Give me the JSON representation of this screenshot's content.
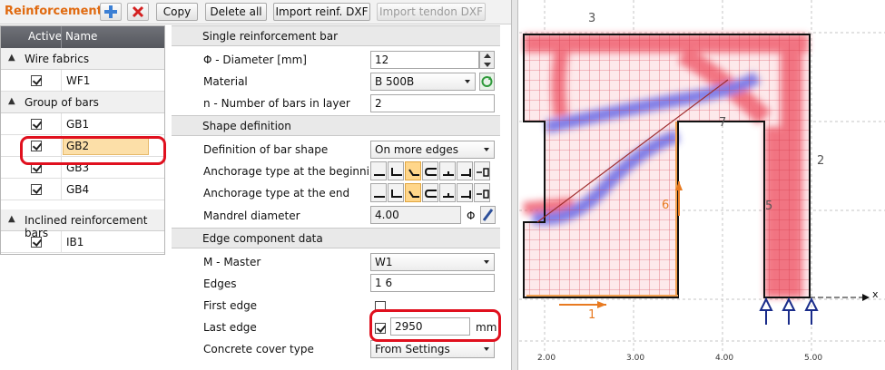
{
  "toolbar": {
    "title": "Reinforcement",
    "add_icon": "plus-icon",
    "delete_icon": "delete-x-icon",
    "copy_label": "Copy",
    "delete_all_label": "Delete all",
    "import_reinf_label": "Import reinf. DXF",
    "import_tendon_label": "Import tendon DXF"
  },
  "tree": {
    "col_active": "Active",
    "col_name": "Name",
    "groups": [
      {
        "label": "Wire fabrics",
        "items": [
          {
            "name": "WF1",
            "active": true
          }
        ]
      },
      {
        "label": "Group of bars",
        "items": [
          {
            "name": "GB1",
            "active": true
          },
          {
            "name": "GB2",
            "active": true,
            "selected": true
          },
          {
            "name": "GB3",
            "active": true
          },
          {
            "name": "GB4",
            "active": true
          }
        ]
      },
      {
        "label": "Inclined reinforcement bars",
        "items": [
          {
            "name": "IB1",
            "active": true
          }
        ]
      }
    ]
  },
  "props": {
    "sec_single": "Single reinforcement bar",
    "diameter_label": "Φ - Diameter [mm]",
    "diameter_value": "12",
    "material_label": "Material",
    "material_value": "B 500B",
    "nbars_label": "n - Number of bars in layer",
    "nbars_value": "2",
    "sec_shape": "Shape definition",
    "shape_def_label": "Definition of bar shape",
    "shape_def_value": "On more edges",
    "anchor_begin_label": "Anchorage type at the beginning",
    "anchor_end_label": "Anchorage type at the end",
    "mandrel_label": "Mandrel diameter",
    "mandrel_value": "4.00",
    "mandrel_unit": "Φ",
    "sec_edge": "Edge component data",
    "master_label": "M - Master",
    "master_value": "W1",
    "edges_label": "Edges",
    "edges_value": "1 6",
    "first_edge_label": "First edge",
    "first_edge_checked": false,
    "last_edge_label": "Last edge",
    "last_edge_checked": true,
    "last_edge_value": "2950",
    "last_edge_unit": "mm",
    "cover_label": "Concrete cover type",
    "cover_value": "From Settings"
  },
  "drawing": {
    "edge_labels": [
      "3",
      "2",
      "7",
      "6",
      "5",
      "1"
    ],
    "axis_x_label": "x",
    "ticks": [
      "2.00",
      "3.00",
      "4.00",
      "5.00"
    ],
    "colors": {
      "tension": "#f06070",
      "compression": "#6a6ae6",
      "accent": "#e87a20"
    }
  }
}
